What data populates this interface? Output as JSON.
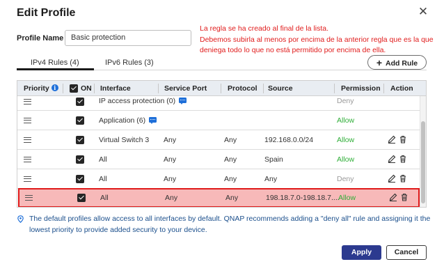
{
  "dialog": {
    "title": "Edit Profile"
  },
  "annotation": "La regla se ha creado al final de la lista.\nDebemos subirla al menos por encima de la anterior regla que es la que deniega todo lo que no está permitido por encima de ella.",
  "profile": {
    "label": "Profile Name",
    "value": "Basic protection"
  },
  "tabs": [
    {
      "label": "IPv4 Rules (4)",
      "active": true
    },
    {
      "label": "IPv6 Rules (3)",
      "active": false
    }
  ],
  "add_rule_label": "Add Rule",
  "table": {
    "headers": {
      "priority": "Priority",
      "on": "ON",
      "interface": "Interface",
      "service_port": "Service Port",
      "protocol": "Protocol",
      "source": "Source",
      "permission": "Permission",
      "action": "Action"
    },
    "rows": [
      {
        "interface": "IP access protection (0)",
        "service_port": "",
        "protocol": "",
        "source": "",
        "permission": "Deny"
      },
      {
        "interface": "Application (6)",
        "service_port": "",
        "protocol": "",
        "source": "",
        "permission": "Allow"
      },
      {
        "interface": "Virtual Switch 3",
        "service_port": "Any",
        "protocol": "Any",
        "source": "192.168.0.0/24",
        "permission": "Allow"
      },
      {
        "interface": "All",
        "service_port": "Any",
        "protocol": "Any",
        "source": "Spain",
        "permission": "Allow"
      },
      {
        "interface": "All",
        "service_port": "Any",
        "protocol": "Any",
        "source": "Any",
        "permission": "Deny"
      },
      {
        "interface": "All",
        "service_port": "Any",
        "protocol": "Any",
        "source": "198.18.7.0-198.18.7....",
        "permission": "Allow"
      }
    ]
  },
  "footnote": "The default profiles allow access to all interfaces by default. QNAP recommends adding a \"deny all\" rule and assigning it the lowest priority to provide added security to your device.",
  "buttons": {
    "apply": "Apply",
    "cancel": "Cancel"
  },
  "colors": {
    "annotation": "#e01b1b",
    "allow": "#2fae38",
    "deny": "#999999",
    "apply_bg": "#2c3a8f",
    "highlight": "#f7b9b9",
    "info": "#1e6fd9"
  },
  "icons": {
    "close": "close-icon",
    "info": "info-icon",
    "drag": "drag-handle-icon",
    "checkbox": "checkbox-checked-icon",
    "edit": "edit-icon",
    "delete": "trash-icon",
    "add": "plus-icon",
    "note": "pin-icon",
    "comment": "comment-icon"
  }
}
